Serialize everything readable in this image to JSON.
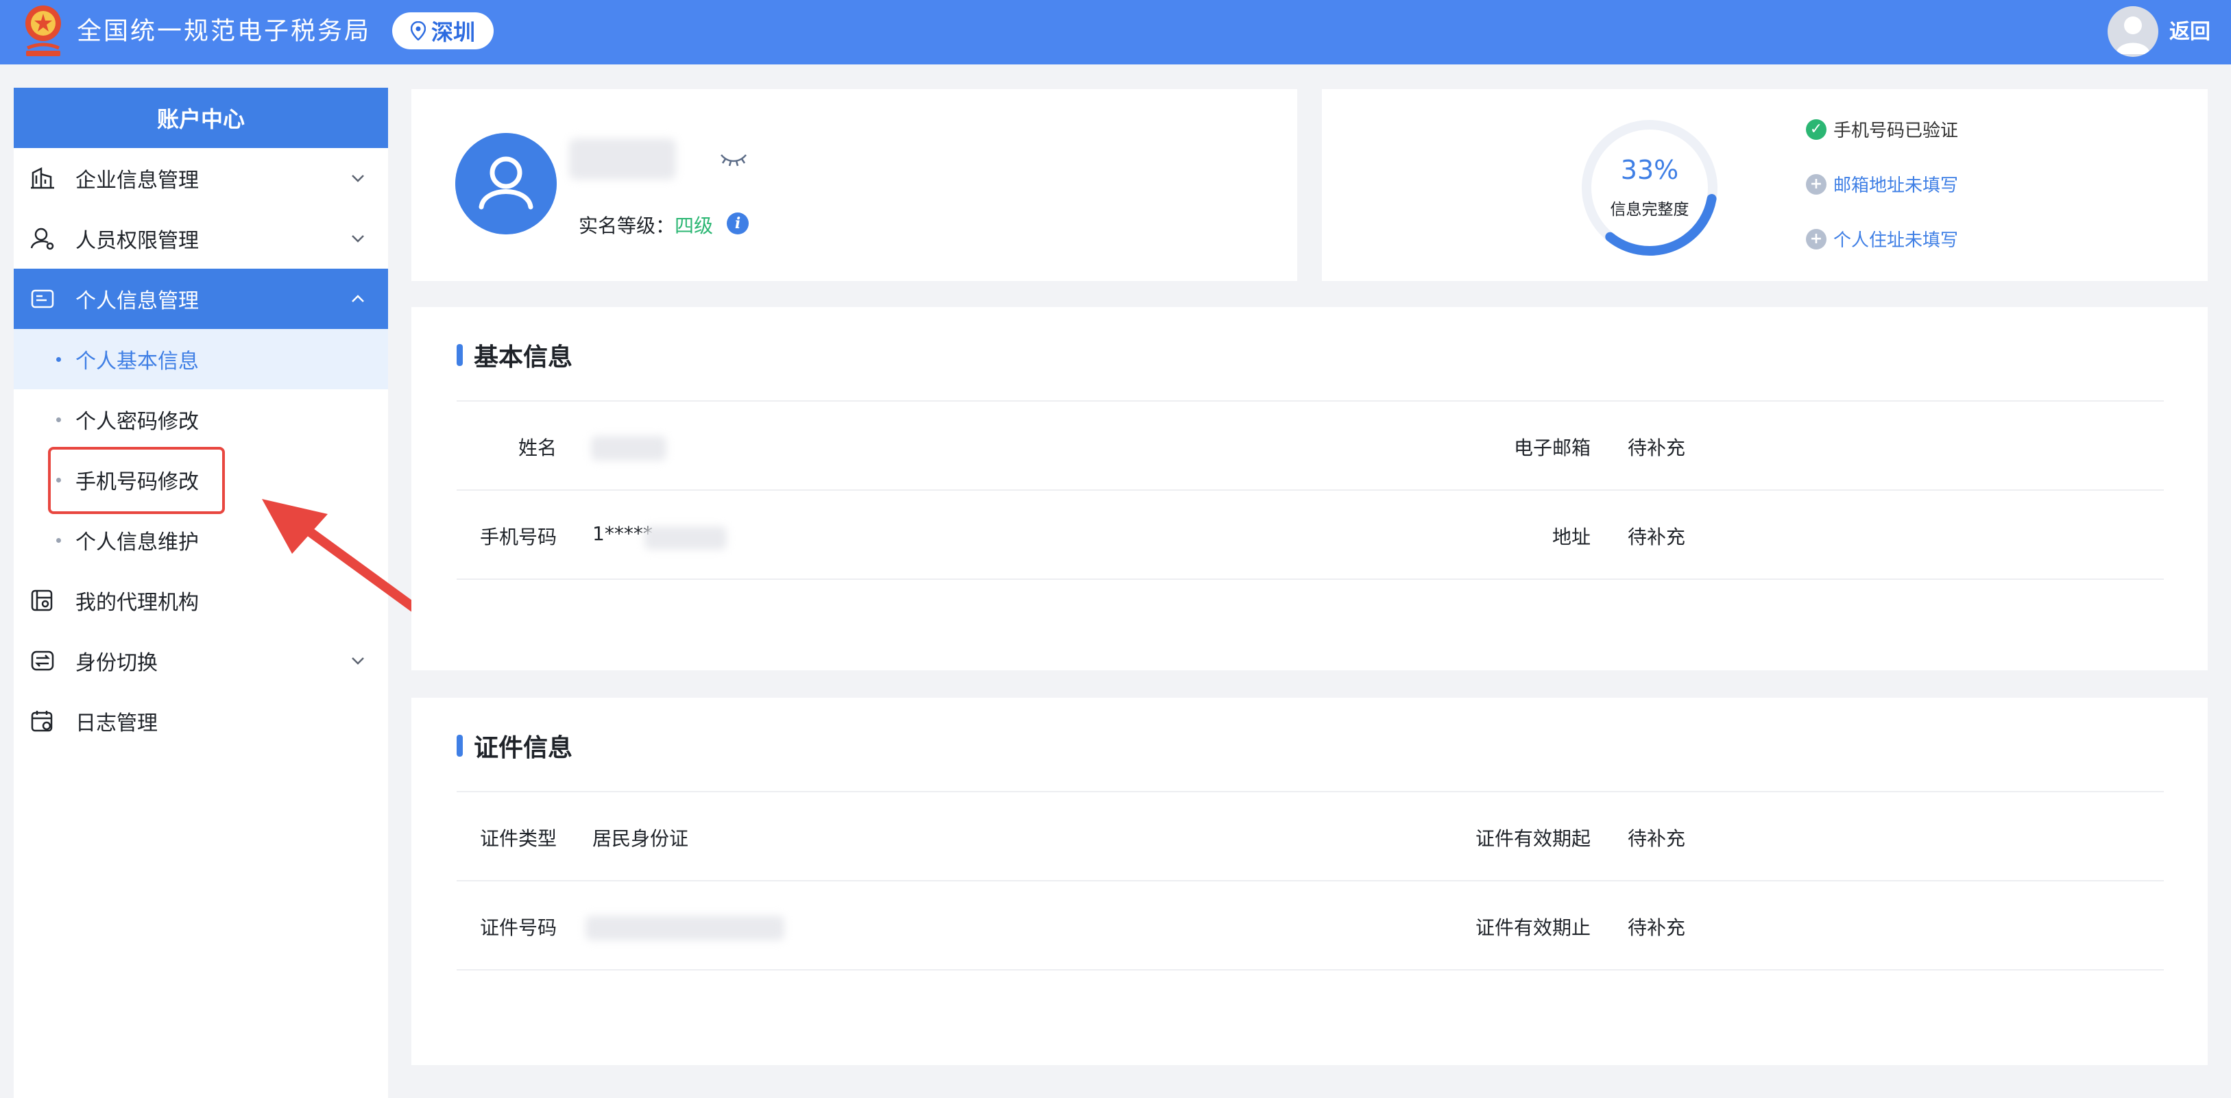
{
  "header": {
    "title": "全国统一规范电子税务局",
    "city": "深圳",
    "back_label": "返回",
    "bg_color": "#4b86f0"
  },
  "sidebar": {
    "title": "账户中心",
    "items": [
      {
        "label": "企业信息管理",
        "icon": "building-icon",
        "expandable": true
      },
      {
        "label": "人员权限管理",
        "icon": "user-key-icon",
        "expandable": true
      },
      {
        "label": "个人信息管理",
        "icon": "id-card-icon",
        "expandable": true,
        "expanded": true,
        "active": true
      },
      {
        "label": "我的代理机构",
        "icon": "agency-icon"
      },
      {
        "label": "身份切换",
        "icon": "switch-icon",
        "expandable": true
      },
      {
        "label": "日志管理",
        "icon": "log-icon"
      }
    ],
    "subitems": [
      {
        "label": "个人基本信息",
        "selected": true
      },
      {
        "label": "个人密码修改"
      },
      {
        "label": "手机号码修改",
        "highlighted": true
      },
      {
        "label": "个人信息维护"
      }
    ]
  },
  "profile": {
    "level_label": "实名等级：",
    "level_value": "四级"
  },
  "completeness": {
    "percent_text": "33%",
    "percent": 33,
    "caption": "信息完整度",
    "status": [
      {
        "text": "手机号码已验证",
        "state": "ok"
      },
      {
        "text": "邮箱地址未填写",
        "state": "missing"
      },
      {
        "text": "个人住址未填写",
        "state": "missing"
      }
    ]
  },
  "basic_info": {
    "title": "基本信息",
    "fields": {
      "name_label": "姓名",
      "email_label": "电子邮箱",
      "email_value": "待补充",
      "phone_label": "手机号码",
      "phone_value": "1*****",
      "address_label": "地址",
      "address_value": "待补充"
    }
  },
  "id_info": {
    "title": "证件信息",
    "fields": {
      "type_label": "证件类型",
      "type_value": "居民身份证",
      "valid_from_label": "证件有效期起",
      "valid_from_value": "待补充",
      "number_label": "证件号码",
      "valid_to_label": "证件有效期止",
      "valid_to_value": "待补充"
    }
  },
  "colors": {
    "accent": "#3f7fe5",
    "success": "#2bb673",
    "highlight": "#e8463f"
  }
}
